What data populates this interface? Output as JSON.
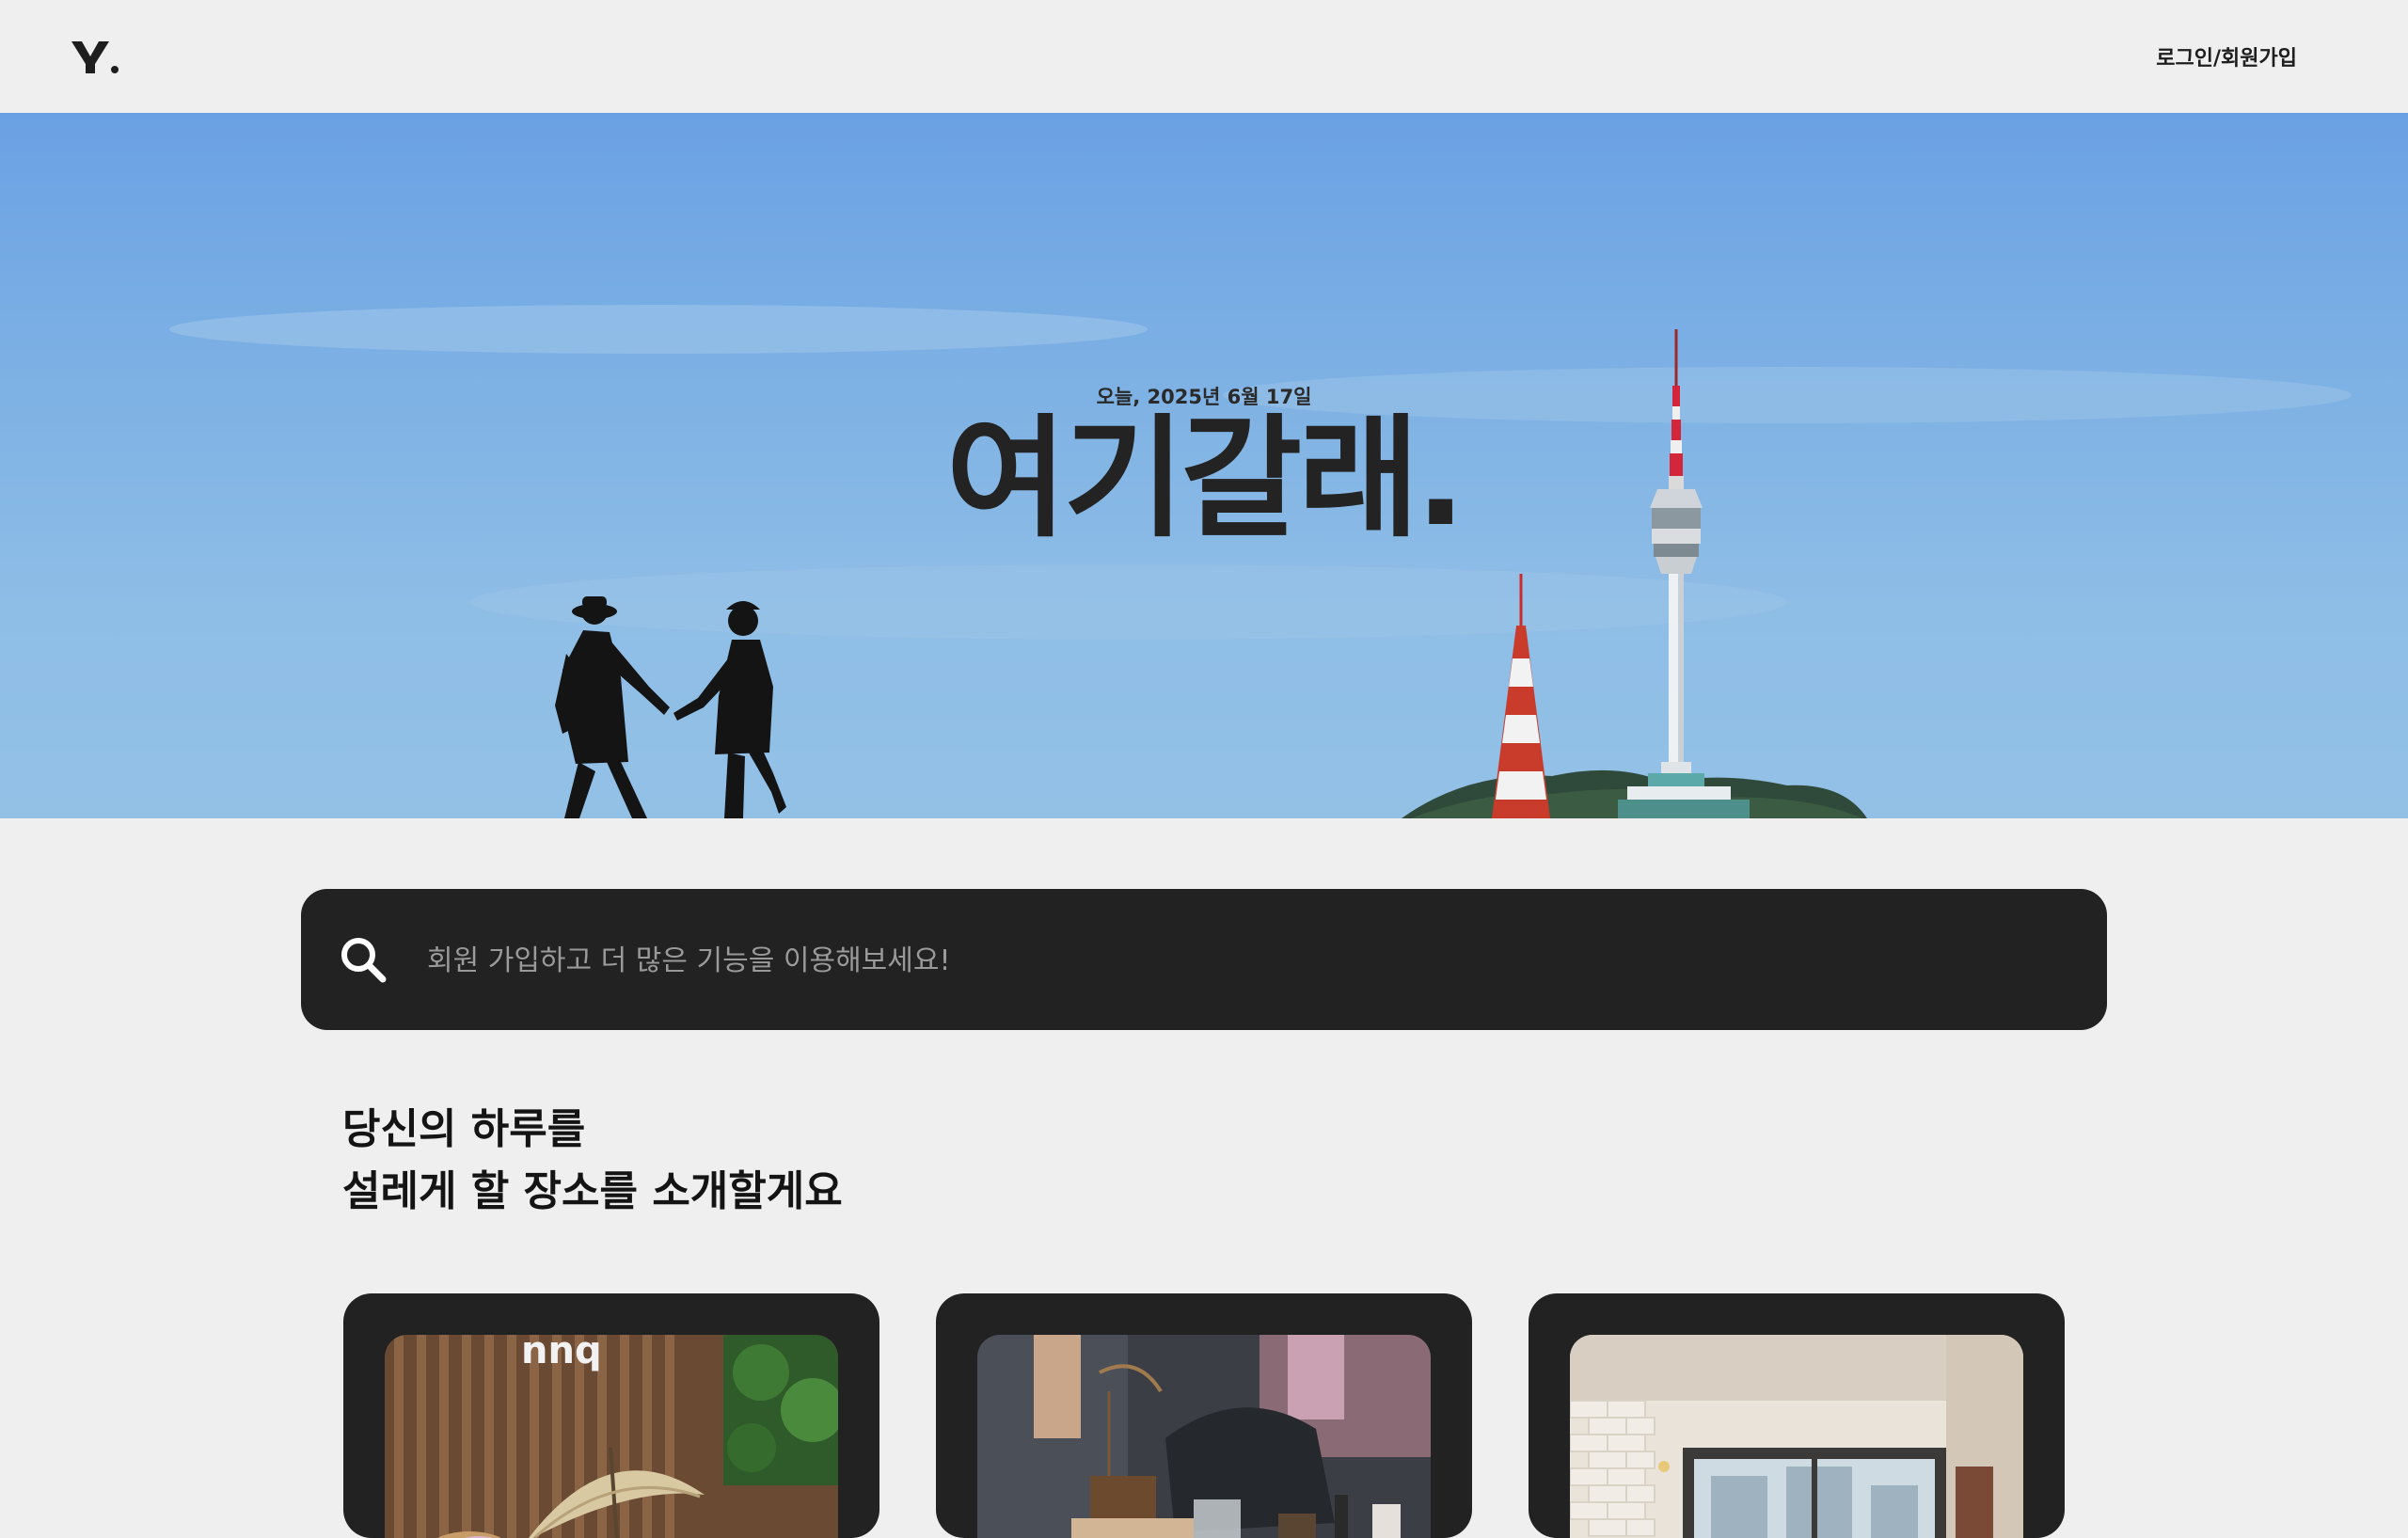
{
  "header": {
    "logo_alt": "Y.",
    "login_label": "로그인/회원가입"
  },
  "hero": {
    "date_label": "오늘, 2025년 6월 17일",
    "title": "여기갈래."
  },
  "search": {
    "placeholder": "회원 가입하고 더 많은 기능을 이용해보세요!"
  },
  "section": {
    "heading_line1": "당신의 하루를",
    "heading_line2": "설레게 할 장소를 소개할게요"
  },
  "cards": [
    {
      "image": "outdoor-market-umbrella-photo"
    },
    {
      "image": "flea-market-stall-photo"
    },
    {
      "image": "cafe-interior-window-photo"
    }
  ],
  "colors": {
    "page_bg": "#efefef",
    "dark_surface": "#222222",
    "sky": "#7cb0e4",
    "tower_red": "#d4263a"
  }
}
